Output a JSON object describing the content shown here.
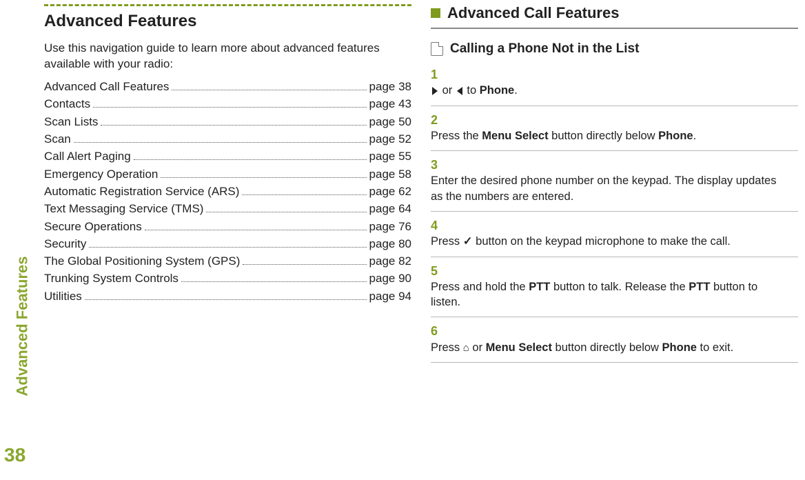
{
  "side_label": "Advanced Features",
  "page_number": "38",
  "left": {
    "heading": "Advanced Features",
    "intro": "Use this navigation guide to learn more about advanced features available with your radio:",
    "toc": [
      {
        "title": "Advanced Call Features",
        "page": "page 38"
      },
      {
        "title": "Contacts",
        "page": "page 43"
      },
      {
        "title": "Scan Lists",
        "page": "page 50"
      },
      {
        "title": "Scan",
        "page": "page 52"
      },
      {
        "title": "Call Alert Paging",
        "page": "page 55"
      },
      {
        "title": "Emergency Operation",
        "page": "page 58"
      },
      {
        "title": "Automatic Registration Service (ARS)",
        "page": "page 62"
      },
      {
        "title": "Text Messaging Service (TMS)",
        "page": "page 64"
      },
      {
        "title": "Secure Operations",
        "page": "page 76"
      },
      {
        "title": "Security",
        "page": "page 80"
      },
      {
        "title": "The Global Positioning System (GPS)",
        "page": "page 82"
      },
      {
        "title": "Trunking System Controls",
        "page": "page 90"
      },
      {
        "title": "Utilities",
        "page": "page 94"
      }
    ]
  },
  "right": {
    "section_title": "Advanced Call Features",
    "sub_title": "Calling a Phone Not in the List",
    "steps": {
      "s1": {
        "num": "1",
        "or": " or ",
        "to": " to ",
        "bold": "Phone",
        "end": "."
      },
      "s2": {
        "num": "2",
        "t1": "Press the ",
        "b1": "Menu Select",
        "t2": " button directly below ",
        "b2": "Phone",
        "t3": "."
      },
      "s3": {
        "num": "3",
        "t1": "Enter the desired phone number on the keypad. The display updates as the numbers are entered."
      },
      "s4": {
        "num": "4",
        "t1": "Press ",
        "suffix": " button on the keypad microphone to make the call."
      },
      "s5": {
        "num": "5",
        "t1": "Press and hold the ",
        "b1": "PTT",
        "t2": " button to talk. Release the ",
        "b2": "PTT",
        "t3": " button to listen."
      },
      "s6": {
        "num": "6",
        "t1": "Press ",
        "t2": " or ",
        "b1": "Menu Select",
        "t3": " button directly below ",
        "b2": "Phone",
        "t4": " to exit."
      }
    }
  }
}
